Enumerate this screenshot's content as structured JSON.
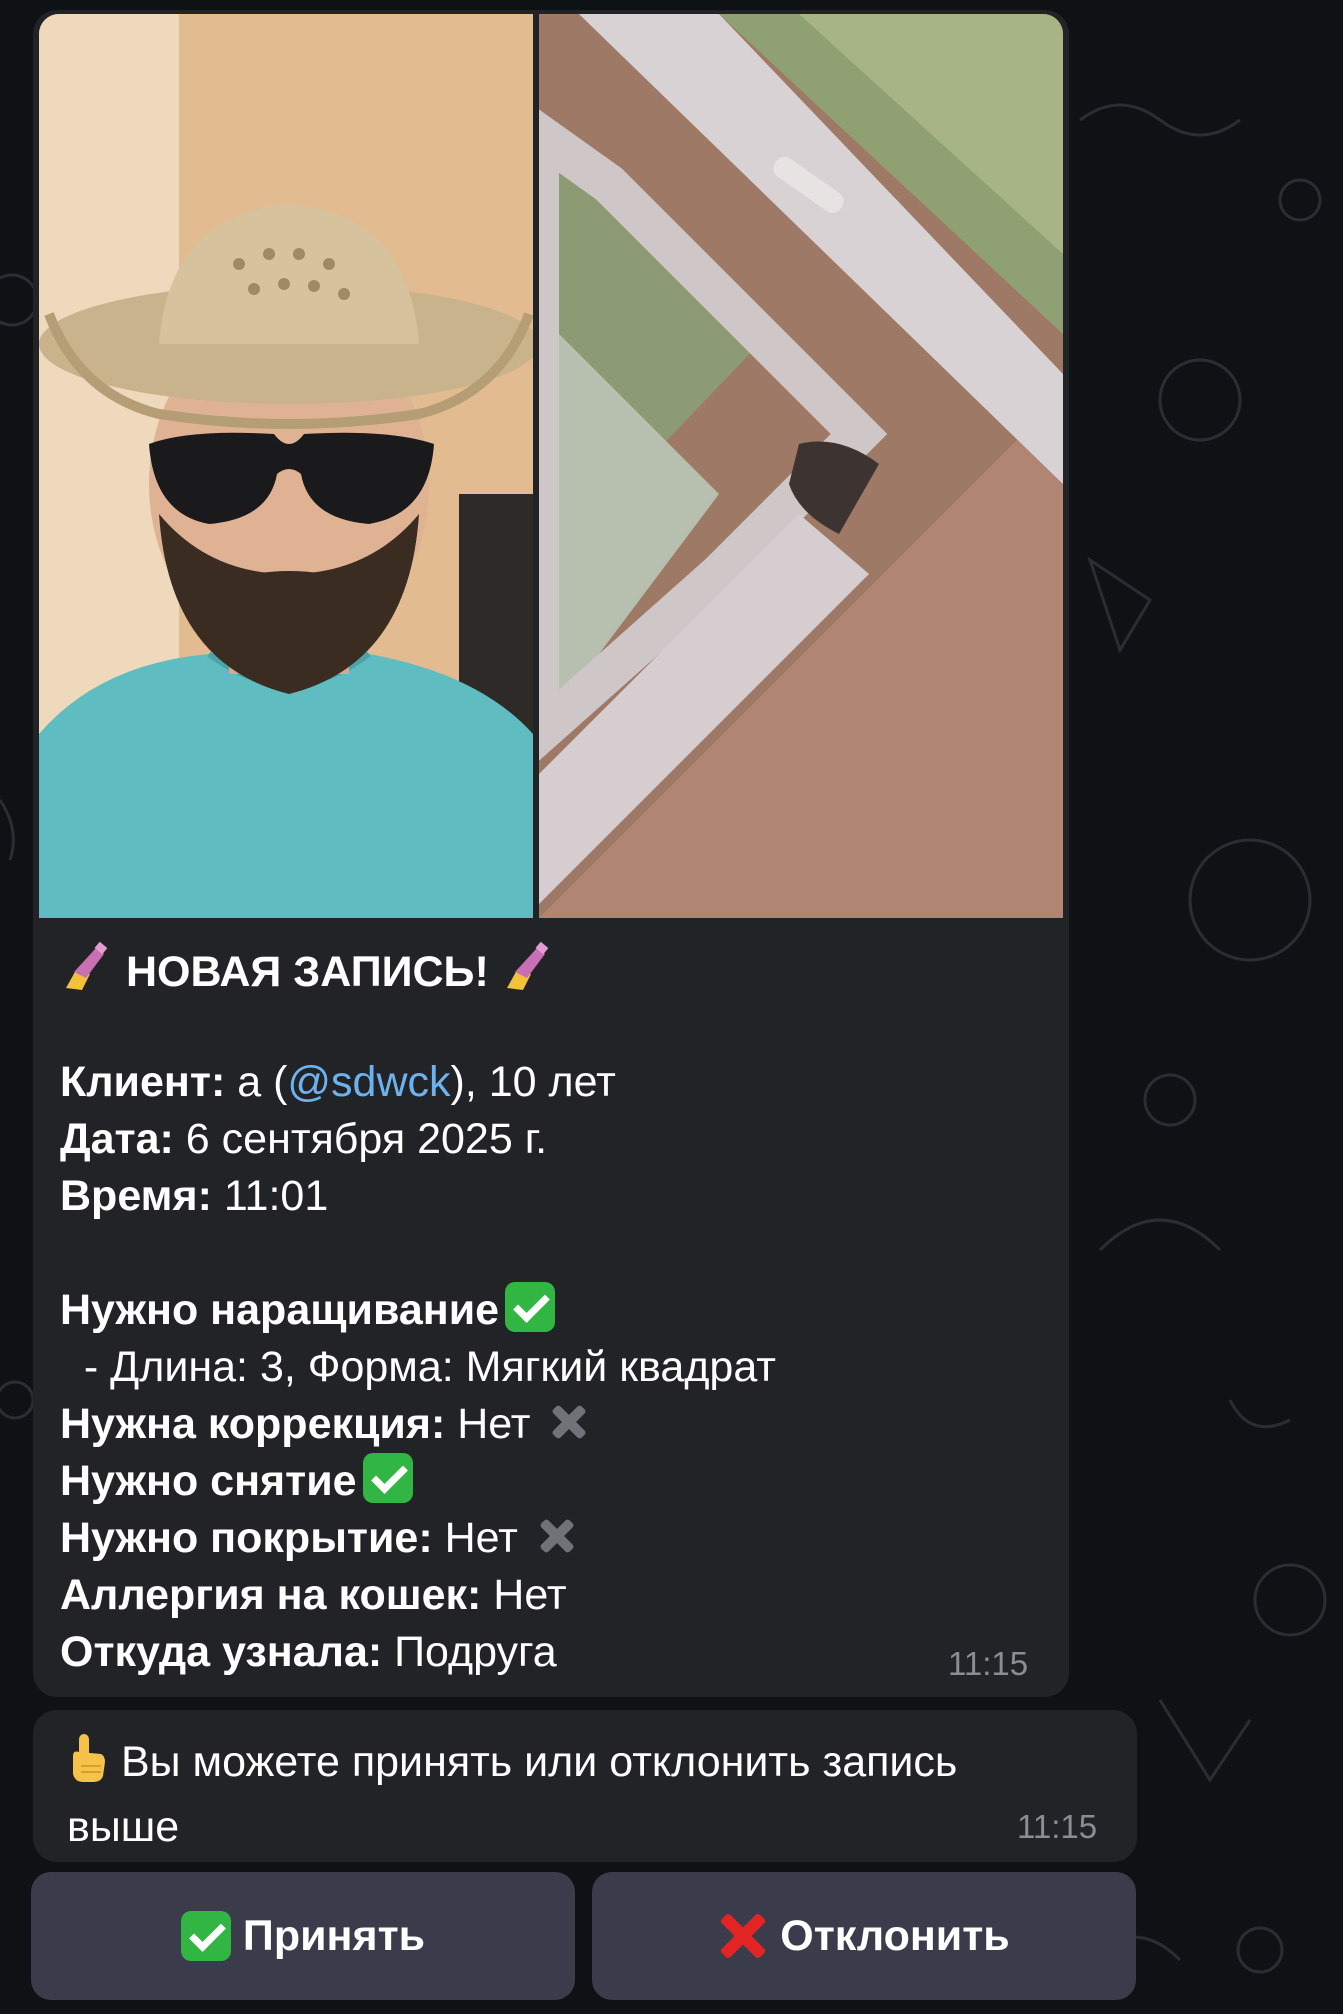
{
  "message": {
    "title": "НОВАЯ ЗАПИСЬ!",
    "client_label": "Клиент:",
    "client_name": " а (",
    "client_username": "@sdwck",
    "client_age": "), 10 лет",
    "date_label": "Дата:",
    "date_value": " 6 сентября 2025 г.",
    "time_label": "Время:",
    "time_value": " 11:01",
    "extension_label": "Нужно наращивание",
    "extension_details": "  - Длина: 3, Форма: Мягкий квадрат",
    "correction_label": "Нужна коррекция:",
    "correction_value": " Нет",
    "removal_label": "Нужно снятие",
    "coating_label": "Нужно покрытие:",
    "coating_value": " Нет",
    "allergy_label": "Аллергия на кошек:",
    "allergy_value": " Нет",
    "source_label": "Откуда узнала:",
    "source_value": " Подруга",
    "timestamp": "11:15"
  },
  "prompt": {
    "text": "Вы можете принять или отклонить запись выше",
    "timestamp": "11:15"
  },
  "buttons": {
    "accept": "Принять",
    "reject": "Отклонить"
  },
  "icons": {
    "title_emoji": "nail-polish-icon",
    "check": "check-mark-button-icon",
    "cross": "cross-mark-icon",
    "pointing": "pointing-up-hand-icon"
  },
  "colors": {
    "bubble": "#212327",
    "link": "#6cb2ee",
    "button": "#3a3c4c",
    "check_green": "#32b643",
    "reject_red": "#e32424"
  }
}
